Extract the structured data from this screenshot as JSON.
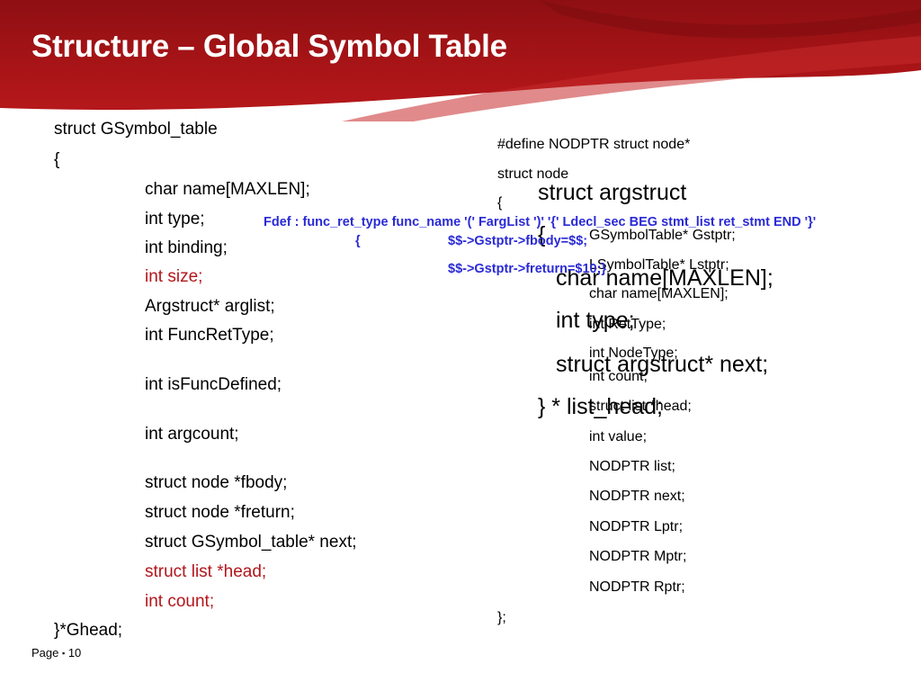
{
  "slide": {
    "title": "Structure – Global Symbol Table",
    "page_label": "Page",
    "page_separator": "▪",
    "page_number": "10"
  },
  "left_code": [
    {
      "text": "struct GSymbol_table",
      "color": "#000000"
    },
    {
      "text": "{",
      "color": "#000000"
    },
    {
      "text": "char name[MAXLEN];",
      "color": "#000000"
    },
    {
      "text": "int type;",
      "color": "#000000"
    },
    {
      "text": "int binding;",
      "color": "#000000"
    },
    {
      "text": "int size;",
      "color": "#b3151b"
    },
    {
      "text": "Argstruct* arglist;",
      "color": "#000000"
    },
    {
      "text": "int FuncRetType;",
      "color": "#000000"
    },
    {
      "text": "int isFuncDefined;",
      "color": "#000000"
    },
    {
      "text": "int argcount;",
      "color": "#000000"
    },
    {
      "text": "struct node  *fbody;",
      "color": "#000000"
    },
    {
      "text": "struct node  *freturn;",
      "color": "#000000"
    },
    {
      "text": "struct GSymbol_table* next;",
      "color": "#000000"
    },
    {
      "text": "struct list *head;",
      "color": "#b3151b"
    },
    {
      "text": "int count;",
      "color": "#b3151b"
    },
    {
      "text": "}*Ghead;",
      "color": "#000000"
    }
  ],
  "right_code": [
    "#define NODPTR struct node*",
    "struct node",
    "{",
    "GSymbolTable* Gstptr;",
    "LSymbolTable* Lstptr;",
    "char name[MAXLEN];",
    "int RetType;",
    "int NodeType;",
    "int count;",
    "struct list *head;",
    "int value;",
    "NODPTR list;",
    "NODPTR next;",
    "NODPTR Lptr;",
    "NODPTR Mptr;",
    "NODPTR Rptr;",
    "};"
  ],
  "argstruct_code": [
    "struct argstruct",
    "{",
    "char name[MAXLEN];",
    "int type;",
    "struct argstruct* next;",
    "} * list_head;"
  ],
  "grammar": {
    "rule": "Fdef : func_ret_type func_name '(' FargList ')' '{' Ldecl_sec BEG stmt_list ret_stmt END '}'",
    "brace": "{",
    "action1": "$$->Gstptr->fbody=$$;",
    "action2": "$$->Gstptr->freturn=$10;}"
  },
  "colors": {
    "header_red": "#a81417",
    "title_text": "#ffffff",
    "highlight_red": "#b3151b",
    "grammar_blue": "#2a2ad6"
  }
}
